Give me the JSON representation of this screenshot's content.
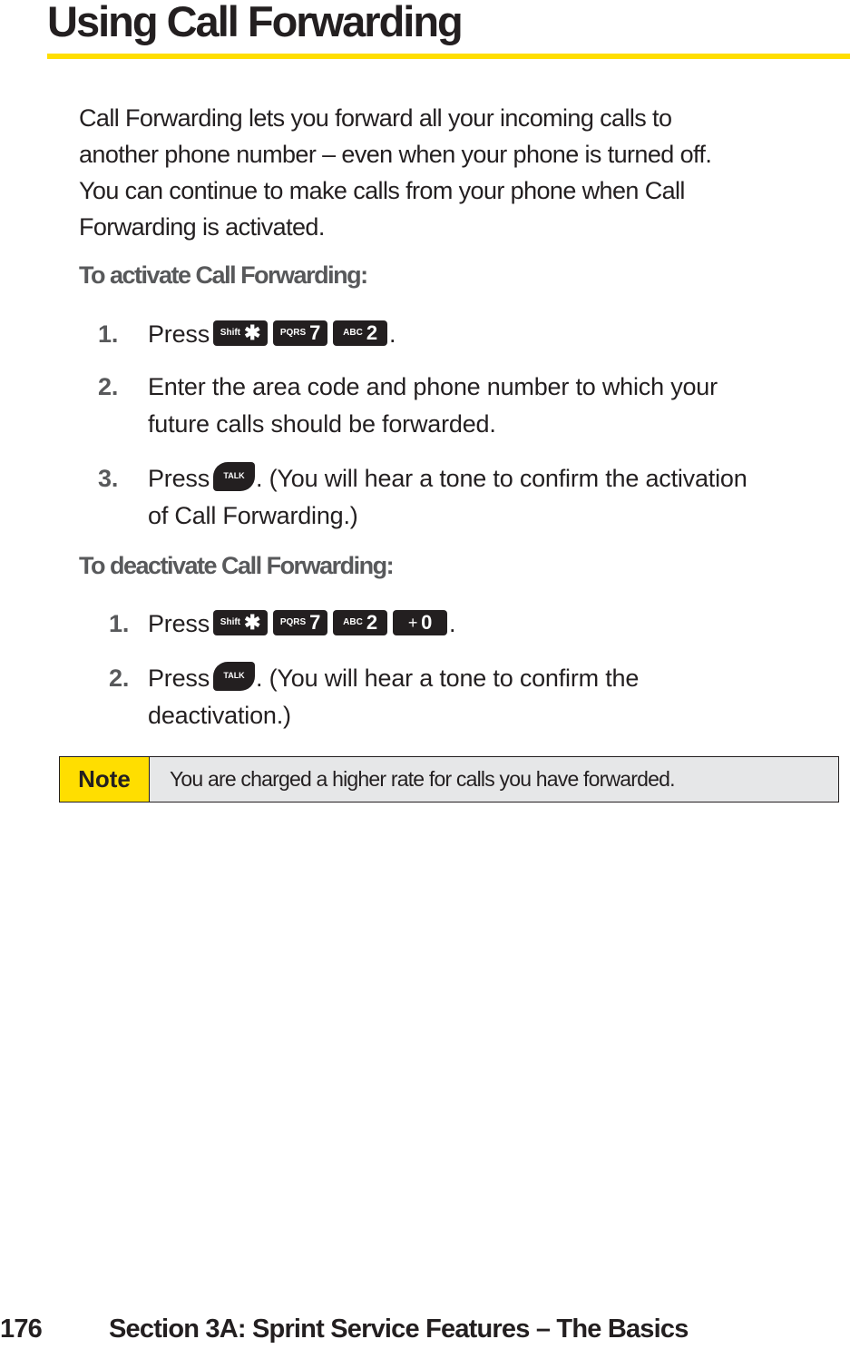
{
  "page": {
    "title": "Using Call Forwarding",
    "intro": "Call Forwarding lets you forward all your incoming calls to another phone number – even when your phone is turned off. You can continue to make calls from your phone when Call Forwarding is activated.",
    "intro_lines": [
      "Call Forwarding lets you forward all your incoming calls to",
      "another phone number – even when your phone is turned off.",
      "You can continue to make calls from your phone when Call",
      "Forwarding is activated."
    ],
    "activate": {
      "heading": "To activate Call Forwarding:",
      "steps": [
        {
          "num": "1.",
          "pre": "Press",
          "keys": [
            {
              "icon": "shift-star-key",
              "small": "Shift",
              "big": "✱"
            },
            {
              "icon": "pqrs-7-key",
              "small": "PQRS",
              "big": "7"
            },
            {
              "icon": "abc-2-key",
              "small": "ABC",
              "big": "2"
            }
          ],
          "post": "."
        },
        {
          "num": "2.",
          "lines": [
            "Enter the area code and phone number to which your",
            "future calls should be forwarded."
          ]
        },
        {
          "num": "3.",
          "pre": "Press",
          "talk_label": "TALK",
          "post": ". (You will hear a tone to confirm the activation",
          "line2": "of Call Forwarding.)"
        }
      ]
    },
    "deactivate": {
      "heading": "To deactivate Call Forwarding:",
      "steps": [
        {
          "num": "1.",
          "pre": "Press",
          "keys": [
            {
              "icon": "shift-star-key",
              "small": "Shift",
              "big": "✱"
            },
            {
              "icon": "pqrs-7-key",
              "small": "PQRS",
              "big": "7"
            },
            {
              "icon": "abc-2-key",
              "small": "ABC",
              "big": "2"
            },
            {
              "icon": "plus-0-key",
              "small": "+",
              "big": "0"
            }
          ],
          "post": "."
        },
        {
          "num": "2.",
          "pre": "Press",
          "talk_label": "TALK",
          "post": ". (You will hear a tone to confirm the",
          "line2": "deactivation.)"
        }
      ]
    },
    "note": {
      "label": "Note",
      "text": "You are charged a higher rate for calls you have forwarded."
    },
    "footer": {
      "page_number": "176",
      "section": "Section 3A: Sprint Service Features – The Basics"
    },
    "colors": {
      "accent_yellow": "#ffde00",
      "text": "#231f20",
      "heading_gray": "#58595b",
      "note_bg": "#e6e7e8"
    }
  }
}
